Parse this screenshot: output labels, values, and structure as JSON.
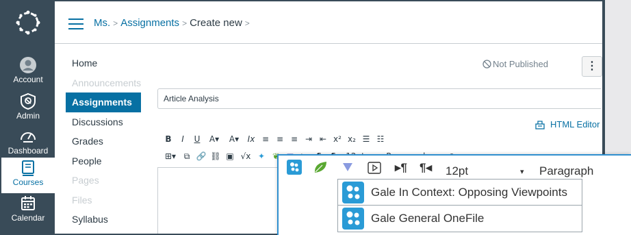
{
  "colors": {
    "nav_bg": "#394b58",
    "accent": "#0770a3",
    "active_text": "#ffffff",
    "zoom_border": "#2f8fcf",
    "gale_blue": "#2a9bd6",
    "leaf_green": "#5aa832"
  },
  "global_nav": {
    "items": [
      {
        "label": "Account",
        "icon": "account-icon"
      },
      {
        "label": "Admin",
        "icon": "admin-icon"
      },
      {
        "label": "Dashboard",
        "icon": "dashboard-icon"
      },
      {
        "label": "Courses",
        "icon": "courses-icon",
        "active": true
      },
      {
        "label": "Calendar",
        "icon": "calendar-icon"
      }
    ]
  },
  "breadcrumb": {
    "course": "Ms.",
    "section": "Assignments",
    "current": "Create new"
  },
  "course_nav": {
    "items": [
      {
        "label": "Home",
        "state": "normal"
      },
      {
        "label": "Announcements",
        "state": "disabled"
      },
      {
        "label": "Assignments",
        "state": "active"
      },
      {
        "label": "Discussions",
        "state": "normal"
      },
      {
        "label": "Grades",
        "state": "normal"
      },
      {
        "label": "People",
        "state": "normal"
      },
      {
        "label": "Pages",
        "state": "disabled"
      },
      {
        "label": "Files",
        "state": "disabled"
      },
      {
        "label": "Syllabus",
        "state": "normal"
      }
    ]
  },
  "status": {
    "not_published": "Not Published",
    "more_label": "⋮"
  },
  "assignment": {
    "title_value": "Article Analysis"
  },
  "editor": {
    "html_editor_label": "HTML Editor",
    "toolbar_row1": [
      "B",
      "I",
      "U",
      "A▾",
      "A▾",
      "Ix",
      "≡",
      "≡",
      "≡",
      "⇥",
      "⇤",
      "x²",
      "x₂",
      "☰",
      "☷"
    ],
    "toolbar_row2": [
      "⊞▾",
      "⧉",
      "🔗",
      "⛓",
      "▣",
      "√x",
      "✦",
      "❦",
      "▼",
      "▷",
      "¶",
      "¶",
      "12pt",
      "▾",
      "Paragraph",
      "▾",
      "⊕"
    ]
  },
  "zoom": {
    "font_size": "12pt",
    "format_arrow": "▾",
    "format": "Paragraph",
    "menu": [
      {
        "label": "Gale In Context: Opposing Viewpoints",
        "icon": "gale-icon"
      },
      {
        "label": "Gale General OneFile",
        "icon": "gale-icon"
      }
    ]
  }
}
